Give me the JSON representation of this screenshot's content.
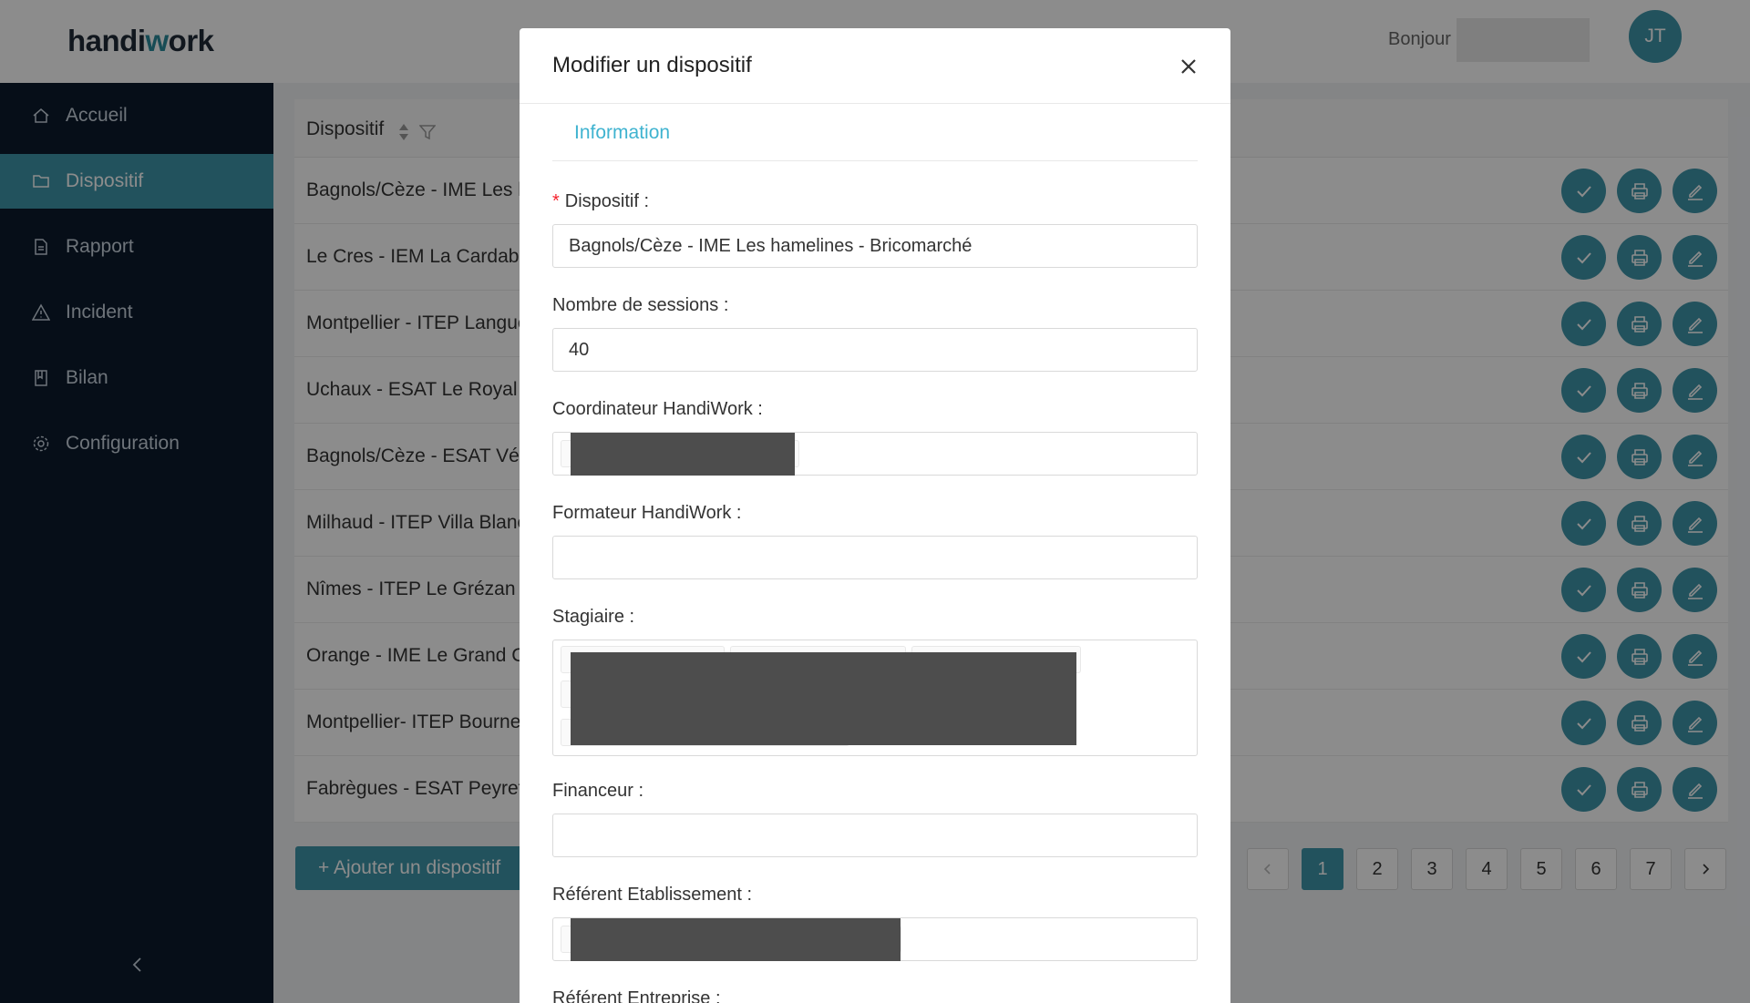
{
  "app": {
    "logo_left": "handi",
    "logo_mid": "w",
    "logo_right": "ork",
    "greeting": "Bonjour",
    "avatar_initials": "JT"
  },
  "colors": {
    "accent": "#3f95a9",
    "sidebar_bg": "#0b1a2c",
    "tab_active": "#3fb3d0",
    "required": "#f5222d"
  },
  "sidebar": {
    "items": [
      {
        "label": "Accueil",
        "icon": "home-icon"
      },
      {
        "label": "Dispositif",
        "icon": "folder-icon",
        "active": true
      },
      {
        "label": "Rapport",
        "icon": "document-icon"
      },
      {
        "label": "Incident",
        "icon": "warning-icon"
      },
      {
        "label": "Bilan",
        "icon": "book-icon"
      },
      {
        "label": "Configuration",
        "icon": "gear-icon"
      }
    ],
    "collapse_icon": "chevron-left-icon"
  },
  "table": {
    "column": "Dispositif",
    "rows": [
      "Bagnols/Cèze - IME Les ha",
      "Le Cres - IEM La Cardabelle",
      "Montpellier - ITEP Langued",
      "Uchaux - ESAT Le Royal - I",
      "Bagnols/Cèze - ESAT Véron",
      "Milhaud - ITEP Villa Blanch",
      "Nîmes - ITEP Le Grézan - E",
      "Orange - IME Le Grand Col",
      "Montpellier- ITEP Bournev",
      "Fabrègues - ESAT Peyrefic"
    ],
    "row_action_icons": [
      "check-icon",
      "print-icon",
      "edit-icon"
    ]
  },
  "add_button": "+ Ajouter un dispositif",
  "pagination": {
    "pages": [
      "1",
      "2",
      "3",
      "4",
      "5",
      "6",
      "7"
    ],
    "current": "1"
  },
  "modal": {
    "title": "Modifier un dispositif",
    "tab": "Information",
    "fields": {
      "dispositif_label": "Dispositif :",
      "dispositif_value": "Bagnols/Cèze - IME Les hamelines - Bricomarché",
      "sessions_label": "Nombre de sessions :",
      "sessions_value": "40",
      "coordinateur_label": "Coordinateur HandiWork :",
      "formateur_label": "Formateur HandiWork :",
      "stagiaire_label": "Stagiaire :",
      "financeur_label": "Financeur :",
      "referent_etab_label": "Référent Etablissement :",
      "referent_entreprise_label": "Référent Entreprise :"
    }
  }
}
